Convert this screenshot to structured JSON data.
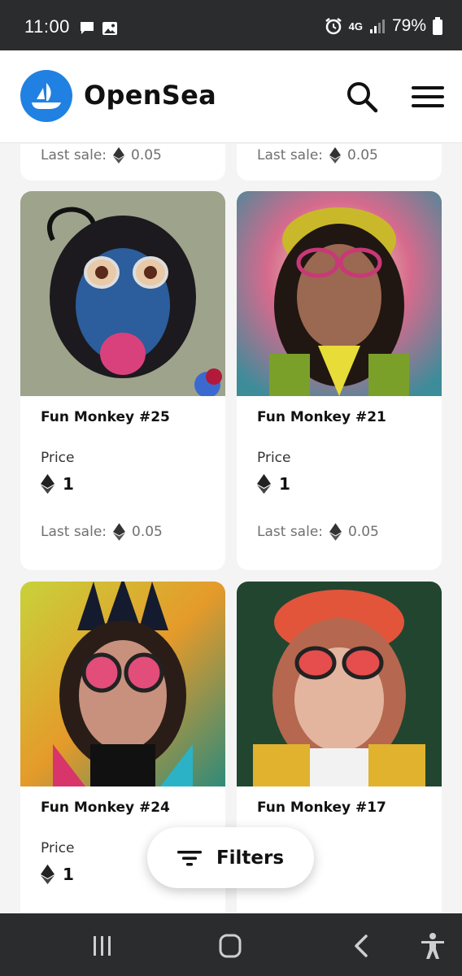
{
  "status_bar": {
    "time": "11:00",
    "network": "4G",
    "battery": "79%",
    "icons": [
      "message-icon",
      "image-icon",
      "alarm-icon",
      "signal-icon",
      "battery-icon"
    ]
  },
  "header": {
    "brand": "OpenSea",
    "logo_color": "#2081e2",
    "icons": [
      "search-icon",
      "menu-icon"
    ]
  },
  "cards_top_stub": [
    {
      "last_sale_label": "Last sale:",
      "last_sale_value": "0.05"
    },
    {
      "last_sale_label": "Last sale:",
      "last_sale_value": "0.05"
    }
  ],
  "cards": [
    {
      "title": "Fun Monkey #25",
      "price_label": "Price",
      "price": "1",
      "last_sale_label": "Last sale:",
      "last_sale_value": "0.05"
    },
    {
      "title": "Fun Monkey #21",
      "price_label": "Price",
      "price": "1",
      "last_sale_label": "Last sale:",
      "last_sale_value": "0.05"
    },
    {
      "title": "Fun Monkey #24",
      "price_label": "Price",
      "price": "1"
    },
    {
      "title": "Fun Monkey #17"
    }
  ],
  "filters": {
    "label": "Filters"
  },
  "nav_bar": {
    "icons": [
      "recent-apps-icon",
      "home-icon",
      "back-icon",
      "accessibility-icon"
    ]
  },
  "colors": {
    "status_bar_bg": "#2b2c2e",
    "page_bg": "#f4f4f5",
    "brand_blue": "#2081e2"
  }
}
